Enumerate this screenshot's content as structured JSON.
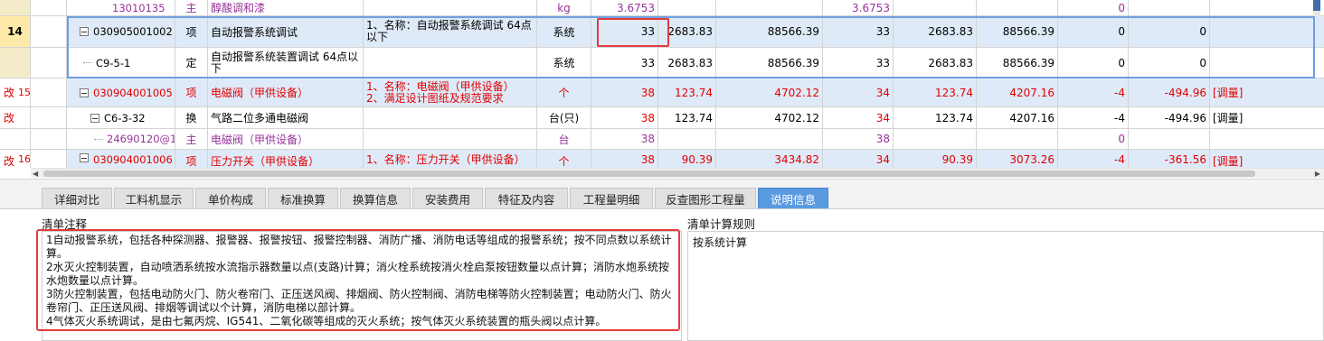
{
  "grid": {
    "row0": {
      "code": "13010135",
      "type": "主",
      "name": "醇酸调和漆",
      "unit": "kg",
      "qty": "3.6753",
      "qty2": "3.6753",
      "c13": "0"
    },
    "row14": {
      "rownum": "14",
      "code": "030905001002",
      "type": "项",
      "name": "自动报警系统调试",
      "feature": "1、名称：自动报警系统调试 64点以下",
      "unit": "系统",
      "qty": "33",
      "price": "2683.83",
      "total": "88566.39",
      "qty2": "33",
      "price2": "2683.83",
      "total2": "88566.39",
      "diff_qty": "0",
      "diff_total": "0"
    },
    "row14sub": {
      "code": "C9-5-1",
      "type": "定",
      "name": "自动报警系统装置调试 64点以下",
      "unit": "系统",
      "qty": "33",
      "price": "2683.83",
      "total": "88566.39",
      "qty2": "33",
      "price2": "2683.83",
      "total2": "88566.39",
      "diff_qty": "0",
      "diff_total": "0"
    },
    "row15": {
      "mark": "改",
      "rownum": "15",
      "code": "030904001005",
      "type": "项",
      "name": "电磁阀（甲供设备）",
      "feature_1": "1、名称：电磁阀（甲供设备）",
      "feature_2": "2、满足设计图纸及规范要求",
      "unit": "个",
      "qty": "38",
      "price": "123.74",
      "total": "4702.12",
      "qty2": "34",
      "price2": "123.74",
      "total2": "4207.16",
      "diff_qty": "-4",
      "diff_total": "-494.96",
      "status": "[调量]"
    },
    "row15sub": {
      "mark": "改",
      "code": "C6-3-32",
      "type": "换",
      "name": "气路二位多通电磁阀",
      "unit": "台(只)",
      "qty": "38",
      "price": "123.74",
      "total": "4702.12",
      "qty2": "34",
      "price2": "123.74",
      "total2": "4207.16",
      "diff_qty": "-4",
      "diff_total": "-494.96",
      "status": "[调量]"
    },
    "row15mat": {
      "code": "24690120@1",
      "type": "主",
      "name": "电磁阀（甲供设备）",
      "unit": "台",
      "qty": "38",
      "qty2": "38",
      "diff_qty": "0"
    },
    "row16": {
      "mark": "改",
      "rownum": "16",
      "code": "030904001006",
      "type": "项",
      "name": "压力开关（甲供设备）",
      "feature": "1、名称：压力开关（甲供设备）",
      "unit": "个",
      "qty": "38",
      "price": "90.39",
      "total": "3434.82",
      "qty2": "34",
      "price2": "90.39",
      "total2": "3073.26",
      "diff_qty": "-4",
      "diff_total": "-361.56",
      "status": "[调量]"
    }
  },
  "tabs": [
    "详细对比",
    "工料机显示",
    "单价构成",
    "标准换算",
    "换算信息",
    "安装费用",
    "特征及内容",
    "工程量明细",
    "反查图形工程量",
    "说明信息"
  ],
  "active_tab": "说明信息",
  "panels": {
    "notes_label": "清单注释",
    "rules_label": "清单计算规则",
    "notes": [
      "1自动报警系统，包括各种探测器、报警器、报警按钮、报警控制器、消防广播、消防电话等组成的报警系统；按不同点数以系统计算。",
      "2水灭火控制装置，自动喷洒系统按水流指示器数量以点(支路)计算；消火栓系统按消火栓启泵按钮数量以点计算；消防水炮系统按水炮数量以点计算。",
      "3防火控制装置，包括电动防火门、防火卷帘门、正压送风阀、排烟阀、防火控制阀、消防电梯等防火控制装置；电动防火门、防火卷帘门、正压送风阀、排烟等调试以个计算，消防电梯以部计算。",
      "4气体灭火系统调试，是由七氟丙烷、IG541、二氧化碳等组成的灭火系统；按气体灭火系统装置的瓶头阀以点计算。"
    ],
    "rule": "按系统计算"
  },
  "colors": {
    "highlight_red": "#e23c3c",
    "selection_blue": "#dfeaf8",
    "active_tab": "#5a9ae0",
    "mod_text": "#e00000",
    "material_text": "#993399"
  }
}
